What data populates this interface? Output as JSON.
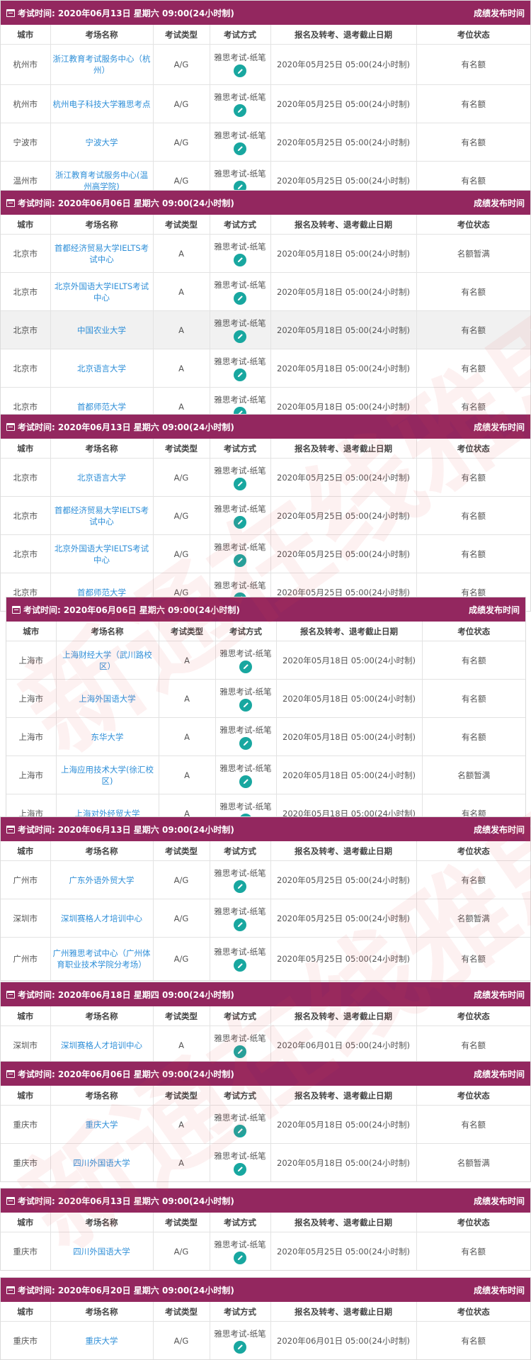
{
  "head_label": "考试时间:",
  "columns": [
    "城市",
    "考场名称",
    "考试类型",
    "考试方式",
    "报名及转考、退考截止日期",
    "考位状态"
  ],
  "pen_icon": "pencil-icon",
  "watermark": "新通在线雅思",
  "sections": [
    {
      "time": "2020年06月13日 星期六 09:00(24小时制)",
      "right": "成绩发布时间",
      "rows": [
        [
          "杭州市",
          "浙江教育考试服务中心（杭州）",
          "A/G",
          "雅思考试-纸笔",
          "2020年05月25日 05:00(24小时制)",
          "有名额"
        ],
        [
          "杭州市",
          "杭州电子科技大学雅思考点",
          "A/G",
          "雅思考试-纸笔",
          "2020年05月25日 05:00(24小时制)",
          "有名额"
        ],
        [
          "宁波市",
          "宁波大学",
          "A/G",
          "雅思考试-纸笔",
          "2020年05月25日 05:00(24小时制)",
          "有名额"
        ],
        [
          "温州市",
          "浙江教育考试服务中心(温州高学院)",
          "A/G",
          "雅思考试-纸笔",
          "2020年05月25日 05:00(24小时制)",
          "有名额"
        ]
      ]
    },
    {
      "time": "2020年06月06日 星期六 09:00(24小时制)",
      "right": "成绩发布时间",
      "rows": [
        [
          "北京市",
          "首都经济贸易大学IELTS考试中心",
          "A",
          "雅思考试-纸笔",
          "2020年05月18日 05:00(24小时制)",
          "名额暂满"
        ],
        [
          "北京市",
          "北京外国语大学IELTS考试中心",
          "A",
          "雅思考试-纸笔",
          "2020年05月18日 05:00(24小时制)",
          "有名额"
        ],
        [
          "北京市",
          "中国农业大学",
          "A",
          "雅思考试-纸笔",
          "2020年05月18日 05:00(24小时制)",
          "有名额"
        ],
        [
          "北京市",
          "北京语言大学",
          "A",
          "雅思考试-纸笔",
          "2020年05月18日 05:00(24小时制)",
          "有名额"
        ],
        [
          "北京市",
          "首都师范大学",
          "A",
          "雅思考试-纸笔",
          "2020年05月18日 05:00(24小时制)",
          "有名额"
        ]
      ]
    },
    {
      "time": "2020年06月13日 星期六 09:00(24小时制)",
      "right": "成绩发布时间",
      "rows": [
        [
          "北京市",
          "北京语言大学",
          "A/G",
          "雅思考试-纸笔",
          "2020年05月25日 05:00(24小时制)",
          "有名额"
        ],
        [
          "北京市",
          "首都经济贸易大学IELTS考试中心",
          "A/G",
          "雅思考试-纸笔",
          "2020年05月25日 05:00(24小时制)",
          "有名额"
        ],
        [
          "北京市",
          "北京外国语大学IELTS考试中心",
          "A/G",
          "雅思考试-纸笔",
          "2020年05月25日 05:00(24小时制)",
          "有名额"
        ],
        [
          "北京市",
          "首都师范大学",
          "A/G",
          "雅思考试-纸笔",
          "2020年05月25日 05:00(24小时制)",
          "有名额"
        ]
      ]
    },
    {
      "time": "2020年06月06日 星期六 09:00(24小时制)",
      "right": "成绩发布时间",
      "rows": [
        [
          "上海市",
          "上海财经大学（武川路校区）",
          "A",
          "雅思考试-纸笔",
          "2020年05月18日 05:00(24小时制)",
          "有名额"
        ],
        [
          "上海市",
          "上海外国语大学",
          "A",
          "雅思考试-纸笔",
          "2020年05月18日 05:00(24小时制)",
          "有名额"
        ],
        [
          "上海市",
          "东华大学",
          "A",
          "雅思考试-纸笔",
          "2020年05月18日 05:00(24小时制)",
          "有名额"
        ],
        [
          "上海市",
          "上海应用技术大学(徐汇校区)",
          "A",
          "雅思考试-纸笔",
          "2020年05月18日 05:00(24小时制)",
          "名额暂满"
        ],
        [
          "上海市",
          "上海对外经贸大学",
          "A",
          "雅思考试-纸笔",
          "2020年05月18日 05:00(24小时制)",
          "有名额"
        ]
      ]
    },
    {
      "time": "2020年06月13日 星期六 09:00(24小时制)",
      "right": "成绩发布时间",
      "rows": [
        [
          "广州市",
          "广东外语外贸大学",
          "A/G",
          "雅思考试-纸笔",
          "2020年05月25日 05:00(24小时制)",
          "有名额"
        ],
        [
          "深圳市",
          "深圳赛格人才培训中心",
          "A/G",
          "雅思考试-纸笔",
          "2020年05月25日 05:00(24小时制)",
          "名额暂满"
        ],
        [
          "广州市",
          "广州雅思考试中心（广州体育职业技术学院分考场）",
          "A/G",
          "雅思考试-纸笔",
          "2020年05月25日 05:00(24小时制)",
          "有名额"
        ]
      ]
    },
    {
      "time": "2020年06月18日 星期四 09:00(24小时制)",
      "right": "成绩发布时间",
      "rows": [
        [
          "深圳市",
          "深圳赛格人才培训中心",
          "A",
          "雅思考试-纸笔",
          "2020年06月01日 05:00(24小时制)",
          "有名额"
        ]
      ]
    },
    {
      "time": "2020年06月06日 星期六 09:00(24小时制)",
      "right": "成绩发布时间",
      "rows": [
        [
          "重庆市",
          "重庆大学",
          "A",
          "雅思考试-纸笔",
          "2020年05月18日 05:00(24小时制)",
          "有名额"
        ],
        [
          "重庆市",
          "四川外国语大学",
          "A",
          "雅思考试-纸笔",
          "2020年05月18日 05:00(24小时制)",
          "名额暂满"
        ]
      ]
    },
    {
      "time": "2020年06月13日 星期六 09:00(24小时制)",
      "right": "成绩发布时间",
      "rows": [
        [
          "重庆市",
          "四川外国语大学",
          "A/G",
          "雅思考试-纸笔",
          "2020年05月25日 05:00(24小时制)",
          "有名额"
        ]
      ]
    },
    {
      "time": "2020年06月20日 星期六 09:00(24小时制)",
      "right": "成绩发布时间",
      "rows": [
        [
          "重庆市",
          "重庆大学",
          "A/G",
          "雅思考试-纸笔",
          "2020年06月01日 05:00(24小时制)",
          "有名额"
        ]
      ]
    }
  ]
}
